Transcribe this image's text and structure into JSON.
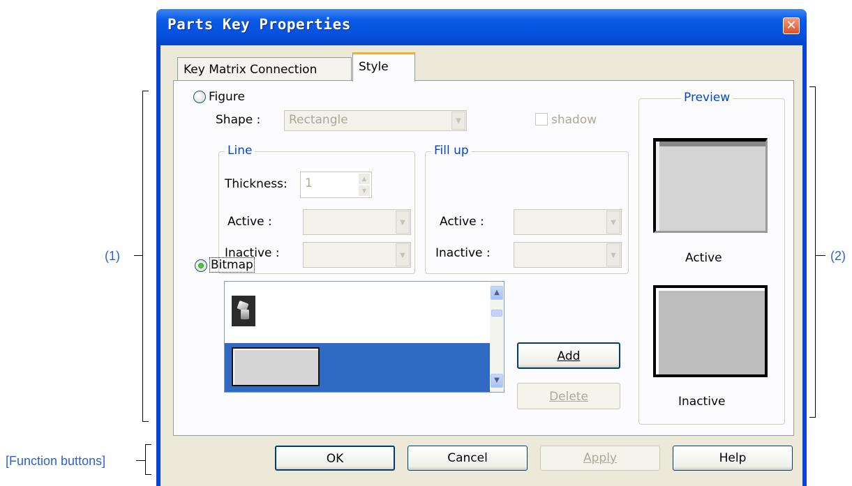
{
  "window": {
    "title": "Parts Key Properties"
  },
  "tabs": [
    {
      "label": "Key Matrix Connection"
    },
    {
      "label": "Style"
    }
  ],
  "figure": {
    "label": "Figure",
    "shape_label": "Shape :",
    "shape_value": "Rectangle",
    "shadow_label": "shadow",
    "line": {
      "title": "Line",
      "thickness_label": "Thickness:",
      "thickness_value": "1",
      "active_label": "Active :",
      "inactive_label": "Inactive :"
    },
    "fill": {
      "title": "Fill up",
      "active_label": "Active :",
      "inactive_label": "Inactive :"
    }
  },
  "bitmap": {
    "label": "Bitmap",
    "add_label": "Add",
    "delete_label": "Delete"
  },
  "preview": {
    "title": "Preview",
    "active_label": "Active",
    "inactive_label": "Inactive"
  },
  "buttons": {
    "ok": "OK",
    "cancel": "Cancel",
    "apply": "Apply",
    "help": "Help"
  },
  "annotations": {
    "area1": "(1)",
    "area2": "(2)",
    "function_buttons": "[Function buttons]"
  },
  "colors": {
    "title_bar": "#0a5be6",
    "selection": "#316ac5",
    "accent_text": "#0046d5",
    "annotation": "#2f5fd0"
  }
}
